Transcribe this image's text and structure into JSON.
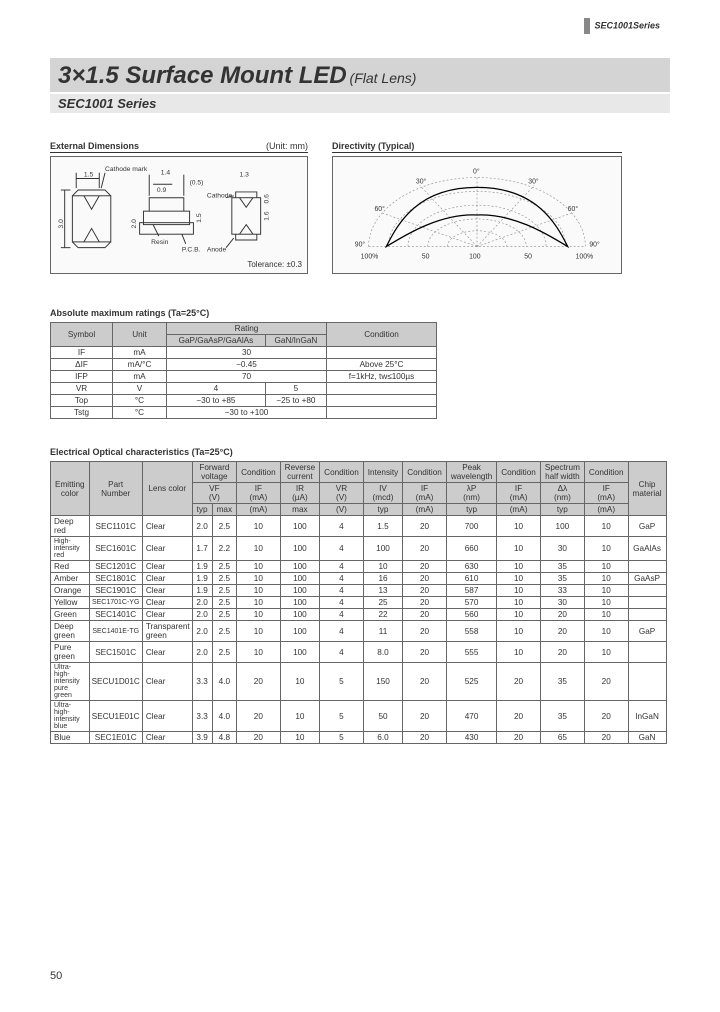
{
  "header_tag": "SEC1001Series",
  "title_main": "3×1.5 Surface Mount LED",
  "title_sub": "(Flat Lens)",
  "subtitle": "SEC1001 Series",
  "page_num": "50",
  "ext_dim": {
    "title": "External Dimensions",
    "unit": "(Unit: mm)",
    "tolerance": "Tolerance: ±0.3",
    "labels": {
      "cathode_mark": "Cathode mark",
      "cathode": "Cathode",
      "anode": "Anode",
      "resin": "Resin",
      "pcb": "P.C.B.",
      "d1_5": "1.5",
      "d3_0": "3.0",
      "d1_4": "1.4",
      "d0_9": "0.9",
      "d0_5": "(0.5)",
      "d2_0": "2.0",
      "d1_5b": "1.5",
      "d1_6": "1.6",
      "d0_6": "0.6",
      "d1_3": "1.3"
    }
  },
  "directivity": {
    "title": "Directivity (Typical)",
    "labels": {
      "a0": "0°",
      "a30l": "30°",
      "a30r": "30°",
      "a60l": "60°",
      "a60r": "60°",
      "a90l": "90°",
      "a90r": "90°",
      "p100l": "100%",
      "p50l": "50",
      "p50r": "50",
      "p100r": "100%",
      "p100t": "100"
    }
  },
  "abs": {
    "title": "Absolute maximum ratings (Ta=25°C)",
    "headers": {
      "symbol": "Symbol",
      "unit": "Unit",
      "rating": "Rating",
      "gap": "GaP/GaAsP/GaAlAs",
      "gan": "GaN/InGaN",
      "condition": "Condition"
    },
    "rows": [
      {
        "sym": "IF",
        "unit": "mA",
        "r1": "30",
        "span": true,
        "cond": ""
      },
      {
        "sym": "ΔIF",
        "unit": "mA/°C",
        "r1": "−0.45",
        "span": true,
        "cond": "Above 25°C"
      },
      {
        "sym": "IFP",
        "unit": "mA",
        "r1": "70",
        "span": true,
        "cond": "f=1kHz, tw≤100µs"
      },
      {
        "sym": "VR",
        "unit": "V",
        "r1": "4",
        "r2": "5",
        "span": false,
        "cond": ""
      },
      {
        "sym": "Top",
        "unit": "°C",
        "r1": "−30 to +85",
        "r2": "−25 to +80",
        "span": false,
        "cond": ""
      },
      {
        "sym": "Tstg",
        "unit": "°C",
        "r1": "−30 to +100",
        "span": true,
        "cond": ""
      }
    ]
  },
  "elec": {
    "title": "Electrical Optical characteristics (Ta=25°C)",
    "headers": {
      "emit": "Emitting color",
      "part": "Part Number",
      "lens": "Lens color",
      "fv": "Forward voltage",
      "vf": "VF",
      "v": "(V)",
      "typ": "typ",
      "max": "max",
      "cond": "Condition",
      "if": "IF",
      "ma": "(mA)",
      "rev": "Reverse current",
      "ir": "IR",
      "ua": "(µA)",
      "vr": "VR",
      "intensity": "Intensity",
      "iv": "IV",
      "mcd": "(mcd)",
      "peak": "Peak wavelength",
      "lp": "λP",
      "nm": "(nm)",
      "spectrum": "Spectrum half width",
      "dl": "Δλ",
      "chip": "Chip material"
    },
    "rows": [
      {
        "color": "Deep red",
        "part": "SEC1101C",
        "lens": "Clear",
        "vft": "2.0",
        "vfm": "2.5",
        "c1": "10",
        "irm": "100",
        "vr": "4",
        "iv": "1.5",
        "c2": "20",
        "lp": "700",
        "c3": "10",
        "dl": "100",
        "c4": "10",
        "chip": "GaP"
      },
      {
        "color": "High-intensity red",
        "part": "SEC1601C",
        "lens": "Clear",
        "vft": "1.7",
        "vfm": "2.2",
        "c1": "10",
        "irm": "100",
        "vr": "4",
        "iv": "100",
        "c2": "20",
        "lp": "660",
        "c3": "10",
        "dl": "30",
        "c4": "10",
        "chip": "GaAlAs"
      },
      {
        "color": "Red",
        "part": "SEC1201C",
        "lens": "Clear",
        "vft": "1.9",
        "vfm": "2.5",
        "c1": "10",
        "irm": "100",
        "vr": "4",
        "iv": "10",
        "c2": "20",
        "lp": "630",
        "c3": "10",
        "dl": "35",
        "c4": "10",
        "chip": ""
      },
      {
        "color": "Amber",
        "part": "SEC1801C",
        "lens": "Clear",
        "vft": "1.9",
        "vfm": "2.5",
        "c1": "10",
        "irm": "100",
        "vr": "4",
        "iv": "16",
        "c2": "20",
        "lp": "610",
        "c3": "10",
        "dl": "35",
        "c4": "10",
        "chip": "GaAsP"
      },
      {
        "color": "Orange",
        "part": "SEC1901C",
        "lens": "Clear",
        "vft": "1.9",
        "vfm": "2.5",
        "c1": "10",
        "irm": "100",
        "vr": "4",
        "iv": "13",
        "c2": "20",
        "lp": "587",
        "c3": "10",
        "dl": "33",
        "c4": "10",
        "chip": ""
      },
      {
        "color": "Yellow",
        "part": "SEC1701C-YG",
        "lens": "Clear",
        "vft": "2.0",
        "vfm": "2.5",
        "c1": "10",
        "irm": "100",
        "vr": "4",
        "iv": "25",
        "c2": "20",
        "lp": "570",
        "c3": "10",
        "dl": "30",
        "c4": "10",
        "chip": ""
      },
      {
        "color": "Green",
        "part": "SEC1401C",
        "lens": "Clear",
        "vft": "2.0",
        "vfm": "2.5",
        "c1": "10",
        "irm": "100",
        "vr": "4",
        "iv": "22",
        "c2": "20",
        "lp": "560",
        "c3": "10",
        "dl": "20",
        "c4": "10",
        "chip": ""
      },
      {
        "color": "Deep green",
        "part": "SEC1401E-TG",
        "lens": "Transparent green",
        "vft": "2.0",
        "vfm": "2.5",
        "c1": "10",
        "irm": "100",
        "vr": "4",
        "iv": "11",
        "c2": "20",
        "lp": "558",
        "c3": "10",
        "dl": "20",
        "c4": "10",
        "chip": "GaP"
      },
      {
        "color": "Pure green",
        "part": "SEC1501C",
        "lens": "Clear",
        "vft": "2.0",
        "vfm": "2.5",
        "c1": "10",
        "irm": "100",
        "vr": "4",
        "iv": "8.0",
        "c2": "20",
        "lp": "555",
        "c3": "10",
        "dl": "20",
        "c4": "10",
        "chip": ""
      },
      {
        "color": "Ultra-high-intensity pure green",
        "part": "SECU1D01C",
        "lens": "Clear",
        "vft": "3.3",
        "vfm": "4.0",
        "c1": "20",
        "irm": "10",
        "vr": "5",
        "iv": "150",
        "c2": "20",
        "lp": "525",
        "c3": "20",
        "dl": "35",
        "c4": "20",
        "chip": ""
      },
      {
        "color": "Ultra-high-intensity blue",
        "part": "SECU1E01C",
        "lens": "Clear",
        "vft": "3.3",
        "vfm": "4.0",
        "c1": "20",
        "irm": "10",
        "vr": "5",
        "iv": "50",
        "c2": "20",
        "lp": "470",
        "c3": "20",
        "dl": "35",
        "c4": "20",
        "chip": "InGaN"
      },
      {
        "color": "Blue",
        "part": "SEC1E01C",
        "lens": "Clear",
        "vft": "3.9",
        "vfm": "4.8",
        "c1": "20",
        "irm": "10",
        "vr": "5",
        "iv": "6.0",
        "c2": "20",
        "lp": "430",
        "c3": "20",
        "dl": "65",
        "c4": "20",
        "chip": "GaN"
      }
    ]
  }
}
